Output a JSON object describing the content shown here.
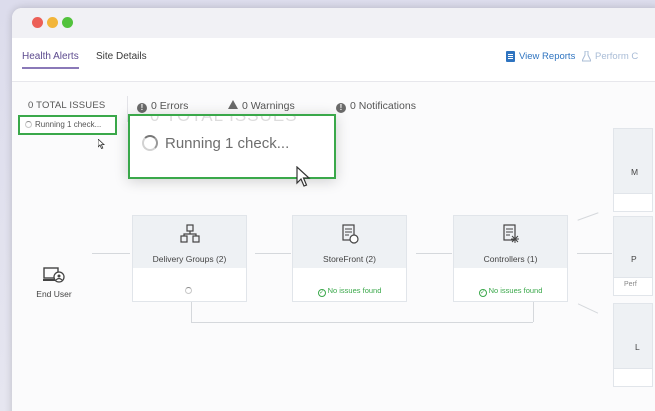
{
  "tabs": {
    "health": "Health Alerts",
    "site": "Site Details"
  },
  "actions": {
    "view_reports": "View Reports",
    "perform": "Perform C"
  },
  "summary": {
    "total": "0 TOTAL ISSUES",
    "errors": "0 Errors",
    "warnings": "0 Warnings",
    "notifications": "0 Notifications",
    "running_small": "Running 1 check..."
  },
  "zoom": {
    "ghost": "0 TOTAL ISSUES",
    "running": "Running 1 check..."
  },
  "nodes": {
    "end_user": "End User",
    "delivery_groups": "Delivery Groups (2)",
    "storefront": "StoreFront (2)",
    "storefront_status": "No issues found",
    "controllers": "Controllers (1)",
    "controllers_status": "No issues found",
    "right_m": "M",
    "right_p": "P",
    "right_perf": "Perf",
    "right_l": "L"
  },
  "colors": {
    "accent_purple": "#5c4a8e",
    "link_blue": "#2f74c0",
    "highlight_green": "#3aa84a",
    "ok_green": "#3aa84a"
  }
}
